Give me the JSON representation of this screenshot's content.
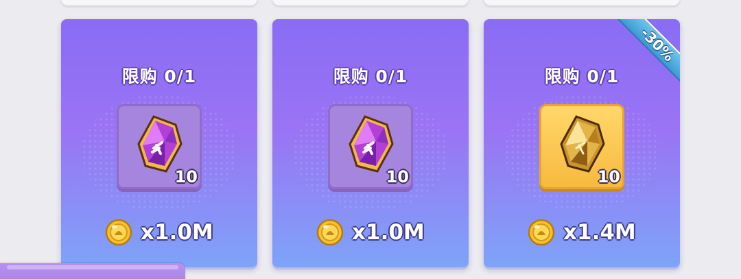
{
  "cards": [
    {
      "limit_label": "限购 0/1",
      "item_icon": "purple-crystal-shard-icon",
      "item_quantity": "10",
      "price": "x1.0M",
      "currency_icon": "gold-coin-icon"
    },
    {
      "limit_label": "限购 0/1",
      "item_icon": "purple-crystal-shard-icon",
      "item_quantity": "10",
      "price": "x1.0M",
      "currency_icon": "gold-coin-icon"
    },
    {
      "limit_label": "限购 0/1",
      "item_icon": "gold-crystal-shard-icon",
      "item_quantity": "10",
      "price": "x1.4M",
      "currency_icon": "gold-coin-icon",
      "discount_badge": "-30%"
    }
  ],
  "colors": {
    "card_top": "#8a6cf5",
    "card_bottom": "#7ea4f8",
    "purple_slot": "#a585dd",
    "gold_slot": "#ffd86a",
    "discount_ribbon": "#4aaee0"
  }
}
